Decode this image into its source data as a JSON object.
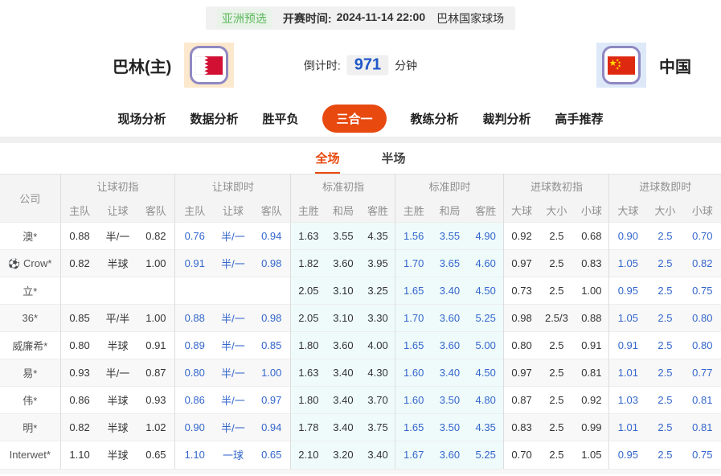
{
  "top_bar": {
    "league": "亚洲预选",
    "kickoff_label": "开赛时间:",
    "kickoff_time": "2024-11-14 22:00",
    "venue": "巴林国家球场"
  },
  "match": {
    "home_name": "巴林(主)",
    "away_name": "中国",
    "countdown_label": "倒计时:",
    "countdown_value": "971",
    "countdown_unit": "分钟"
  },
  "nav": {
    "items": [
      {
        "key": "live-analysis",
        "label": "现场分析",
        "active": false
      },
      {
        "key": "data-analysis",
        "label": "数据分析",
        "active": false
      },
      {
        "key": "win-draw-lose",
        "label": "胜平负",
        "active": false
      },
      {
        "key": "three-in-one",
        "label": "三合一",
        "active": true
      },
      {
        "key": "coach-analysis",
        "label": "教练分析",
        "active": false
      },
      {
        "key": "referee-analysis",
        "label": "裁判分析",
        "active": false
      },
      {
        "key": "expert-picks",
        "label": "高手推荐",
        "active": false
      }
    ]
  },
  "subtabs": {
    "items": [
      {
        "key": "full-match",
        "label": "全场",
        "active": true
      },
      {
        "key": "half-match",
        "label": "半场",
        "active": false
      }
    ]
  },
  "table": {
    "company_header": "公司",
    "groups": [
      {
        "label": "让球初指",
        "cols": [
          "主队",
          "让球",
          "客队"
        ],
        "live": false,
        "tint": false
      },
      {
        "label": "让球即时",
        "cols": [
          "主队",
          "让球",
          "客队"
        ],
        "live": true,
        "tint": false
      },
      {
        "label": "标准初指",
        "cols": [
          "主胜",
          "和局",
          "客胜"
        ],
        "live": false,
        "tint": true
      },
      {
        "label": "标准即时",
        "cols": [
          "主胜",
          "和局",
          "客胜"
        ],
        "live": true,
        "tint": true
      },
      {
        "label": "进球数初指",
        "cols": [
          "大球",
          "大小",
          "小球"
        ],
        "live": false,
        "tint": false
      },
      {
        "label": "进球数即时",
        "cols": [
          "大球",
          "大小",
          "小球"
        ],
        "live": true,
        "tint": false
      }
    ],
    "rows": [
      {
        "company": "澳*",
        "icon": false,
        "cells": [
          "0.88",
          "半/一",
          "0.82",
          "0.76",
          "半/一",
          "0.94",
          "1.63",
          "3.55",
          "4.35",
          "1.56",
          "3.55",
          "4.90",
          "0.92",
          "2.5",
          "0.68",
          "0.90",
          "2.5",
          "0.70"
        ]
      },
      {
        "company": "Crow*",
        "icon": true,
        "cells": [
          "0.82",
          "半球",
          "1.00",
          "0.91",
          "半/一",
          "0.98",
          "1.82",
          "3.60",
          "3.95",
          "1.70",
          "3.65",
          "4.60",
          "0.97",
          "2.5",
          "0.83",
          "1.05",
          "2.5",
          "0.82"
        ]
      },
      {
        "company": "立*",
        "icon": false,
        "cells": [
          "",
          "",
          "",
          "",
          "",
          "",
          "2.05",
          "3.10",
          "3.25",
          "1.65",
          "3.40",
          "4.50",
          "0.73",
          "2.5",
          "1.00",
          "0.95",
          "2.5",
          "0.75"
        ]
      },
      {
        "company": "36*",
        "icon": false,
        "cells": [
          "0.85",
          "平/半",
          "1.00",
          "0.88",
          "半/一",
          "0.98",
          "2.05",
          "3.10",
          "3.30",
          "1.70",
          "3.60",
          "5.25",
          "0.98",
          "2.5/3",
          "0.88",
          "1.05",
          "2.5",
          "0.80"
        ]
      },
      {
        "company": "威廉希*",
        "icon": false,
        "cells": [
          "0.80",
          "半球",
          "0.91",
          "0.89",
          "半/一",
          "0.85",
          "1.80",
          "3.60",
          "4.00",
          "1.65",
          "3.60",
          "5.00",
          "0.80",
          "2.5",
          "0.91",
          "0.91",
          "2.5",
          "0.80"
        ]
      },
      {
        "company": "易*",
        "icon": false,
        "cells": [
          "0.93",
          "半/一",
          "0.87",
          "0.80",
          "半/一",
          "1.00",
          "1.63",
          "3.40",
          "4.30",
          "1.60",
          "3.40",
          "4.50",
          "0.97",
          "2.5",
          "0.81",
          "1.01",
          "2.5",
          "0.77"
        ]
      },
      {
        "company": "伟*",
        "icon": false,
        "cells": [
          "0.86",
          "半球",
          "0.93",
          "0.86",
          "半/一",
          "0.97",
          "1.80",
          "3.40",
          "3.70",
          "1.60",
          "3.50",
          "4.80",
          "0.87",
          "2.5",
          "0.92",
          "1.03",
          "2.5",
          "0.81"
        ]
      },
      {
        "company": "明*",
        "icon": false,
        "cells": [
          "0.82",
          "半球",
          "1.02",
          "0.90",
          "半/一",
          "0.94",
          "1.78",
          "3.40",
          "3.75",
          "1.65",
          "3.50",
          "4.35",
          "0.83",
          "2.5",
          "0.99",
          "1.01",
          "2.5",
          "0.81"
        ]
      },
      {
        "company": "Interwet*",
        "icon": false,
        "cells": [
          "1.10",
          "半球",
          "0.65",
          "1.10",
          "一球",
          "0.65",
          "2.10",
          "3.20",
          "3.40",
          "1.67",
          "3.60",
          "5.25",
          "0.70",
          "2.5",
          "1.05",
          "0.95",
          "2.5",
          "0.75"
        ]
      }
    ]
  },
  "icons": {
    "soccer_ball": "⚽"
  },
  "colors": {
    "accent": "#e8490f",
    "live": "#3366cc",
    "green": "#5cb85c",
    "tint": "#effbfb",
    "countdown": "#2058c8"
  }
}
